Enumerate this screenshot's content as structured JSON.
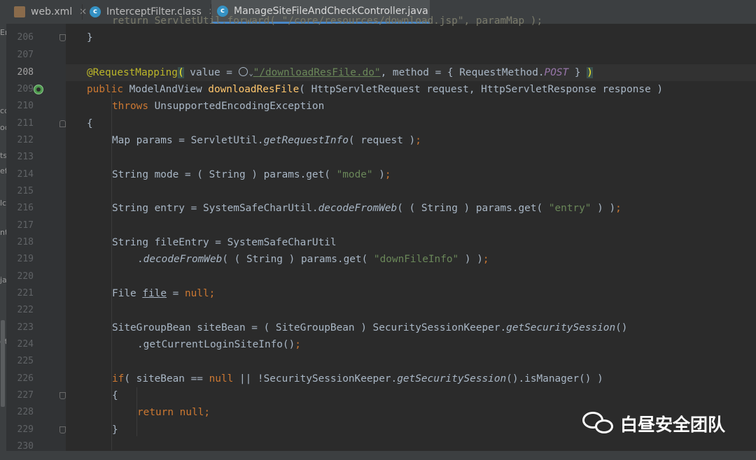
{
  "tabs": [
    {
      "label": "web.xml",
      "icon": "xml-file-icon",
      "active": false
    },
    {
      "label": "InterceptFilter.class",
      "icon": "class-file-icon",
      "active": false
    },
    {
      "label": "ManageSiteFileAndCheckController.java",
      "icon": "java-class-icon",
      "active": true
    }
  ],
  "left_strip_fragments": [
    "Er",
    "cc",
    "oc",
    "ts",
    "ef",
    "lc",
    "nt",
    "ja",
    "ot"
  ],
  "lines": [
    {
      "num": "206"
    },
    {
      "num": "207"
    },
    {
      "num": "208"
    },
    {
      "num": "209"
    },
    {
      "num": "210"
    },
    {
      "num": "211"
    },
    {
      "num": "212"
    },
    {
      "num": "213"
    },
    {
      "num": "214"
    },
    {
      "num": "215"
    },
    {
      "num": "216"
    },
    {
      "num": "217"
    },
    {
      "num": "218"
    },
    {
      "num": "219"
    },
    {
      "num": "220"
    },
    {
      "num": "221"
    },
    {
      "num": "222"
    },
    {
      "num": "223"
    },
    {
      "num": "224"
    },
    {
      "num": "225"
    },
    {
      "num": "226"
    },
    {
      "num": "227"
    },
    {
      "num": "228"
    },
    {
      "num": "229"
    },
    {
      "num": "230"
    }
  ],
  "code": {
    "l205_partial": "return ServletUtil.forward( \"/core/resources/download.jsp\", paramMap );",
    "l206": "}",
    "l208": {
      "annotation": "@RequestMapping",
      "paren_open": "(",
      "a": " value = ",
      "url": "\"/downloadResFile.do\"",
      "b": ", method = { RequestMethod.",
      "post": "POST",
      "c": " } ",
      "paren_close": ")"
    },
    "l209": {
      "kw": "public",
      "a": " ModelAndView ",
      "fn": "downloadResFile",
      "b": "( HttpServletRequest request, HttpServletResponse response )"
    },
    "l210": {
      "kw": "throws",
      "a": " UnsupportedEncodingException"
    },
    "l211": "{",
    "l212": {
      "a": "Map params = ServletUtil.",
      "it": "getRequestInfo",
      "b": "( request )",
      "semi": ";"
    },
    "l214": {
      "a": "String mode = ( String ) params.get( ",
      "str": "\"mode\"",
      "b": " )",
      "semi": ";"
    },
    "l216": {
      "a": "String entry = SystemSafeCharUtil.",
      "it": "decodeFromWeb",
      "b": "( ( String ) params.get( ",
      "str": "\"entry\"",
      "c": " ) )",
      "semi": ";"
    },
    "l218": "String fileEntry = SystemSafeCharUtil",
    "l219": {
      "a": ".",
      "it": "decodeFromWeb",
      "b": "( ( String ) params.get( ",
      "str": "\"downFileInfo\"",
      "c": " ) )",
      "semi": ";"
    },
    "l221": {
      "a": "File ",
      "var": "file",
      "b": " = ",
      "kw": "null",
      "semi": ";"
    },
    "l223": {
      "a": "SiteGroupBean siteBean = ( SiteGroupBean ) SecuritySessionKeeper.",
      "it": "getSecuritySession",
      "b": "()"
    },
    "l224": {
      "a": ".getCurrentLoginSiteInfo()",
      "semi": ";"
    },
    "l226": {
      "kw": "if",
      "a": "( siteBean == ",
      "kw2": "null",
      "b": " || !SecuritySessionKeeper.",
      "it": "getSecuritySession",
      "c": "().isManager() )"
    },
    "l227": "{",
    "l228": {
      "kw": "return",
      "sp": " ",
      "kw2": "null",
      "semi": ";"
    },
    "l229": "}"
  },
  "watermark": {
    "text": "白昼安全团队",
    "icon": "wechat-icon"
  },
  "colors": {
    "keyword": "#cc7832",
    "string": "#6a8759",
    "annotation": "#bbb529",
    "method": "#ffc66d",
    "constant": "#9876aa",
    "text": "#a9b7c6",
    "background": "#2b2b2b"
  }
}
